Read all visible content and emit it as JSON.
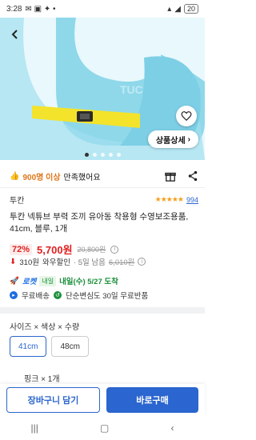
{
  "status": {
    "time": "3:28",
    "battery": "20"
  },
  "hero": {
    "detail_button": "상품상세"
  },
  "promo": {
    "count": "900명 이상",
    "suffix": "만족했어요"
  },
  "product": {
    "brand": "투칸",
    "rating_stars": "★★★★★",
    "review_count": "994",
    "title": "투칸 넥튜브 부력 조끼 유아동 착용형 수영보조용품, 41cm, 블루, 1개"
  },
  "price": {
    "discount": "72%",
    "sale": "5,700원",
    "original": "20,800원",
    "coupon_amount": "310원",
    "coupon_label": "와우할인",
    "coupon_note": "· 5일 남음",
    "coupon_old": "6,010원"
  },
  "delivery": {
    "rocket": "로켓",
    "tag": "내일",
    "arrival": "내일(수) 5/27 도착"
  },
  "benefits": {
    "free_shipping": "무료배송",
    "free_return": "단순변심도 30일 무료반품"
  },
  "options": {
    "label": "사이즈 × 색상 × 수량",
    "sizes": [
      "41cm",
      "48cm"
    ],
    "selected_size": "41cm",
    "sub_option": "핑크 × 1개"
  },
  "actions": {
    "cart": "장바구니 담기",
    "buy": "바로구매"
  },
  "colors": {
    "accent": "#2b65cf",
    "price": "#e02020",
    "arrival": "#1a8f3a"
  }
}
